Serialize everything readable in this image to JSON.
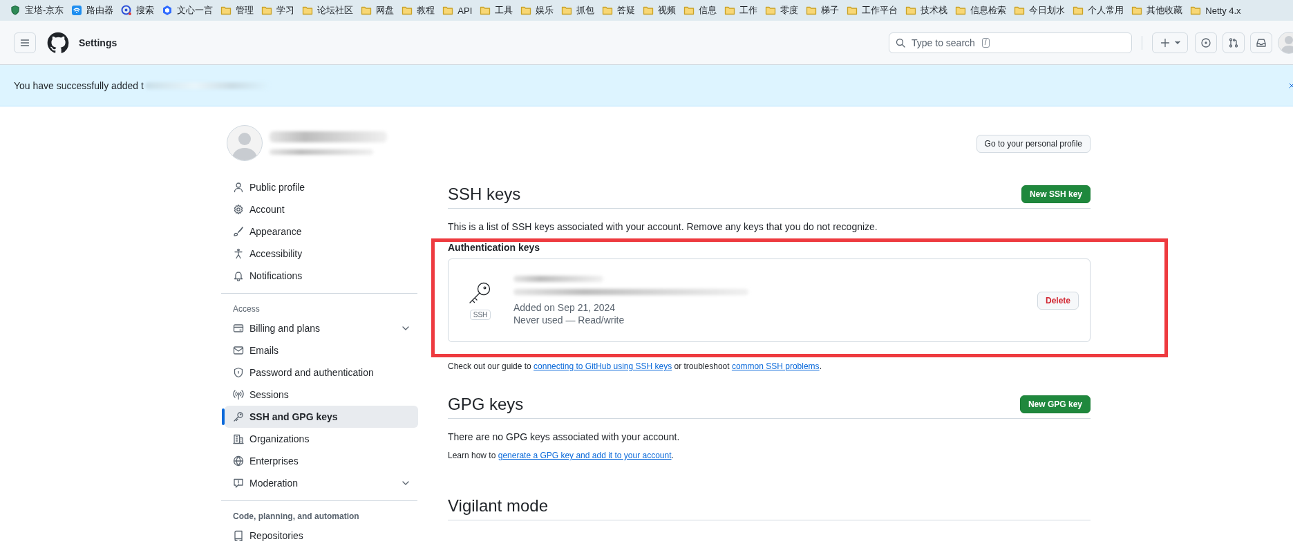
{
  "bookmarks": [
    {
      "label": "宝塔-京东",
      "kind": "site"
    },
    {
      "label": "路由器",
      "kind": "site"
    },
    {
      "label": "搜索",
      "kind": "site"
    },
    {
      "label": "文心一言",
      "kind": "site"
    },
    {
      "label": "管理",
      "kind": "folder"
    },
    {
      "label": "学习",
      "kind": "folder"
    },
    {
      "label": "论坛社区",
      "kind": "folder"
    },
    {
      "label": "网盘",
      "kind": "folder"
    },
    {
      "label": "教程",
      "kind": "folder"
    },
    {
      "label": "API",
      "kind": "folder"
    },
    {
      "label": "工具",
      "kind": "folder"
    },
    {
      "label": "娱乐",
      "kind": "folder"
    },
    {
      "label": "抓包",
      "kind": "folder"
    },
    {
      "label": "答疑",
      "kind": "folder"
    },
    {
      "label": "视频",
      "kind": "folder"
    },
    {
      "label": "信息",
      "kind": "folder"
    },
    {
      "label": "工作",
      "kind": "folder"
    },
    {
      "label": "零度",
      "kind": "folder"
    },
    {
      "label": "梯子",
      "kind": "folder"
    },
    {
      "label": "工作平台",
      "kind": "folder"
    },
    {
      "label": "技术栈",
      "kind": "folder"
    },
    {
      "label": "信息检索",
      "kind": "folder"
    },
    {
      "label": "今日划水",
      "kind": "folder"
    },
    {
      "label": "个人常用",
      "kind": "folder"
    },
    {
      "label": "其他收藏",
      "kind": "folder"
    },
    {
      "label": "Netty 4.x",
      "kind": "folder"
    }
  ],
  "header": {
    "title": "Settings",
    "search": {
      "placeholder": "Type to search",
      "shortcut": "/"
    }
  },
  "flash": {
    "message": "You have successfully added t"
  },
  "profile": {
    "button": "Go to your personal profile"
  },
  "sidebar": {
    "groups": [
      {
        "items": [
          {
            "label": "Public profile",
            "kind": "link",
            "selected": false
          },
          {
            "label": "Account",
            "kind": "link",
            "selected": false
          },
          {
            "label": "Appearance",
            "kind": "link",
            "selected": false
          },
          {
            "label": "Accessibility",
            "kind": "link",
            "selected": false
          },
          {
            "label": "Notifications",
            "kind": "link",
            "selected": false
          }
        ]
      },
      {
        "heading": "Access",
        "items": [
          {
            "label": "Billing and plans",
            "kind": "dropdown",
            "selected": false
          },
          {
            "label": "Emails",
            "kind": "link",
            "selected": false
          },
          {
            "label": "Password and authentication",
            "kind": "link",
            "selected": false
          },
          {
            "label": "Sessions",
            "kind": "link",
            "selected": false
          },
          {
            "label": "SSH and GPG keys",
            "kind": "link",
            "selected": true
          },
          {
            "label": "Organizations",
            "kind": "link",
            "selected": false
          },
          {
            "label": "Enterprises",
            "kind": "link",
            "selected": false
          },
          {
            "label": "Moderation",
            "kind": "dropdown",
            "selected": false
          }
        ]
      },
      {
        "heading": "Code, planning, and automation",
        "items": [
          {
            "label": "Repositories",
            "kind": "link",
            "selected": false
          }
        ]
      }
    ]
  },
  "ssh": {
    "title": "SSH keys",
    "new_button": "New SSH key",
    "description": "This is a list of SSH keys associated with your account. Remove any keys that you do not recognize.",
    "subheading": "Authentication keys",
    "keys": [
      {
        "badge": "SSH",
        "added": "Added on Sep 21, 2024",
        "usage": "Never used — Read/write",
        "delete_button": "Delete"
      }
    ],
    "help": {
      "prefix": "Check out our guide to ",
      "link1": "connecting to GitHub using SSH keys",
      "middle": " or troubleshoot ",
      "link2": "common SSH problems",
      "suffix": "."
    }
  },
  "gpg": {
    "title": "GPG keys",
    "new_button": "New GPG key",
    "empty": "There are no GPG keys associated with your account.",
    "learn": {
      "prefix": "Learn how to ",
      "link": "generate a GPG key and add it to your account",
      "suffix": "."
    }
  },
  "vigilant": {
    "title": "Vigilant mode"
  }
}
